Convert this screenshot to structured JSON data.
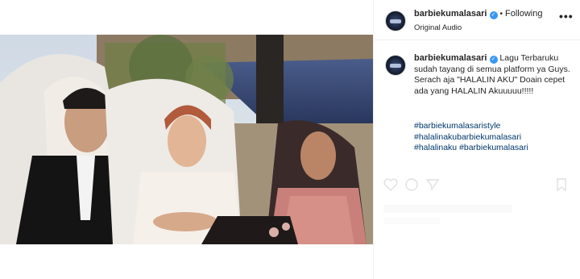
{
  "header": {
    "username": "barbiekumalasari",
    "separator": "•",
    "follow_status": "Following",
    "audio": "Original Audio",
    "more": "•••"
  },
  "caption": {
    "username": "barbiekumalasari",
    "text": "Lagu Terbaruku sudah tayang di semua platform ya Guys. Serach aja \"HALALIN AKU\" Doain cepet ada yang HALALIN Akuuuuu!!!!!",
    "hashtags": [
      "#barbiekumalasaristyle",
      "#halalinakubarbiekumalasari",
      "#halalinaku #barbiekumalasari"
    ]
  },
  "icons": {
    "verified": "verified-badge-icon",
    "mute": "speaker-muted-icon",
    "more": "more-options-icon"
  },
  "colors": {
    "verified": "#3897f0",
    "hashtag": "#00376b",
    "text": "#262626"
  }
}
